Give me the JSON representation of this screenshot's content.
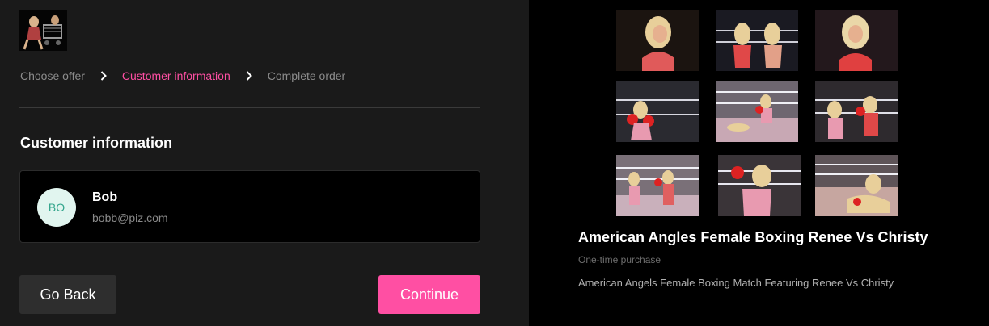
{
  "brand": {
    "logo_icon": "wrestling-thumbnail-logo"
  },
  "steps": [
    {
      "label": "Choose offer",
      "state": "done"
    },
    {
      "label": "Customer information",
      "state": "active"
    },
    {
      "label": "Complete order",
      "state": "pending"
    }
  ],
  "section": {
    "title": "Customer information"
  },
  "customer": {
    "initials": "BO",
    "name": "Bob",
    "email": "bobb@piz.com"
  },
  "buttons": {
    "back_label": "Go Back",
    "continue_label": "Continue"
  },
  "product": {
    "title": "American Angles Female Boxing Renee Vs Christy",
    "purchase_type": "One-time purchase",
    "description": "American Angels Female Boxing Match Featuring Renee Vs Christy",
    "collage_icon": "boxing-match-collage"
  },
  "colors": {
    "accent": "#ff4fa3",
    "panel_bg": "#1a1a1a",
    "right_bg": "#000000",
    "avatar_bg": "#e1f5ef",
    "avatar_text": "#33a58c"
  }
}
